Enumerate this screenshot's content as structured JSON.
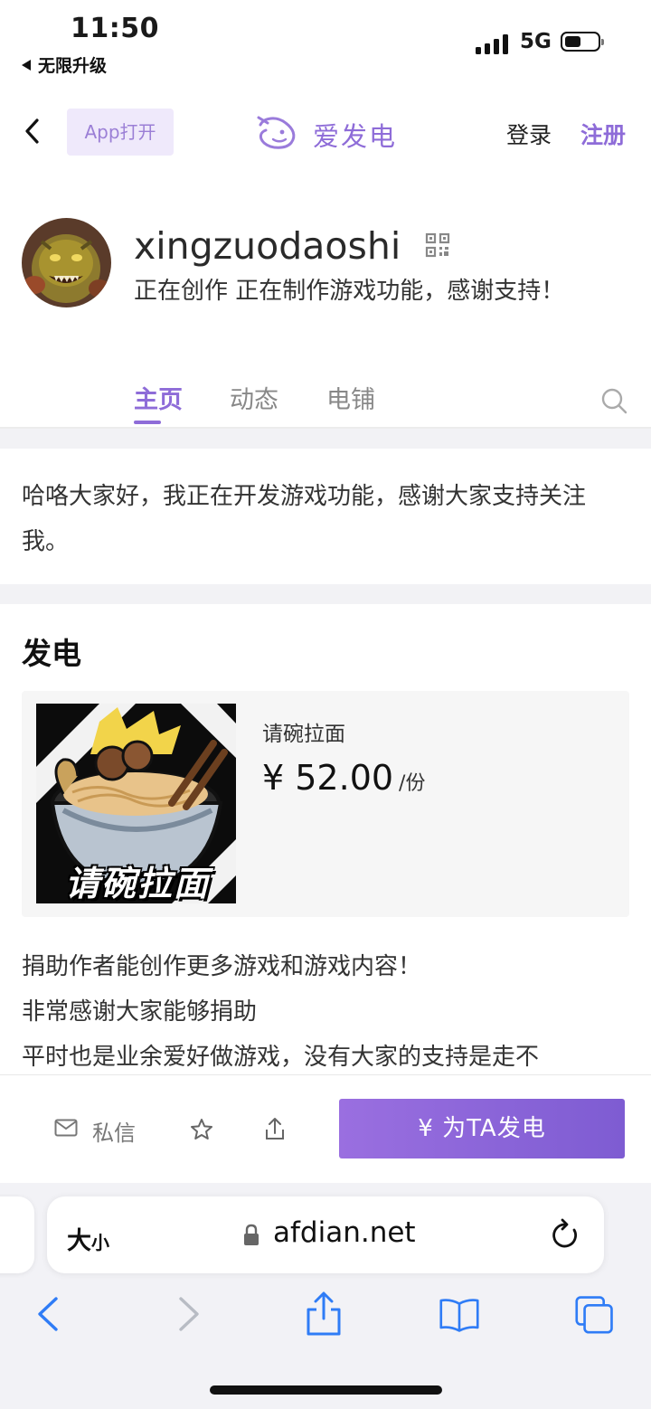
{
  "status_bar": {
    "time": "11:50",
    "back_app": "无限升级",
    "network": "5G"
  },
  "header": {
    "open_app": "App打开",
    "brand": "爱发电",
    "login": "登录",
    "register": "注册"
  },
  "profile": {
    "username": "xingzuodaoshi",
    "bio": "正在创作 正在制作游戏功能，感谢支持！"
  },
  "tabs": [
    {
      "label": "主页",
      "active": true
    },
    {
      "label": "动态",
      "active": false
    },
    {
      "label": "电铺",
      "active": false
    }
  ],
  "intro": "哈咯大家好，我正在开发游戏功能，感谢大家支持关注我。",
  "support": {
    "section_title": "发电",
    "plan": {
      "image_text": "请碗拉面",
      "name": "请碗拉面",
      "price": "¥ 52.00",
      "unit": "/份"
    },
    "description": "捐助作者能创作更多游戏和游戏内容！\n非常感谢大家能够捐助\n平时也是业余爱好做游戏，没有大家的支持是走不"
  },
  "action_bar": {
    "message": "私信",
    "donate": "¥  为TA发电"
  },
  "safari": {
    "text_size": "大",
    "text_size_small": "小",
    "url": "afdian.net"
  },
  "colors": {
    "accent": "#8e6cd8",
    "button": "#8b65d9"
  }
}
